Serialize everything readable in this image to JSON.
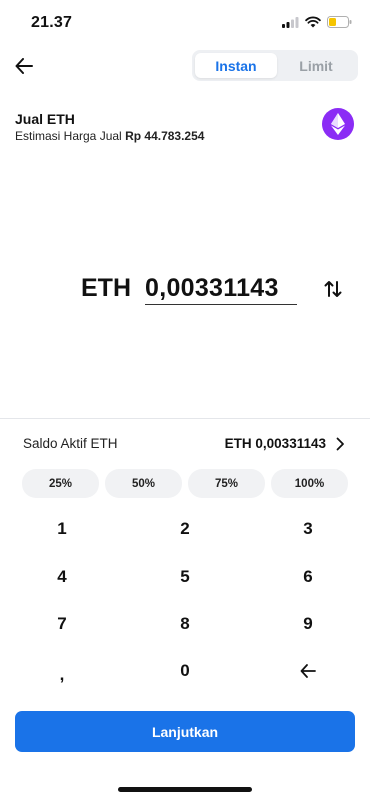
{
  "status_bar": {
    "time": "21.37"
  },
  "header": {
    "tabs": [
      {
        "label": "Instan",
        "active": true
      },
      {
        "label": "Limit",
        "active": false
      }
    ]
  },
  "sell": {
    "title": "Jual ETH",
    "estimate_label": "Estimasi Harga Jual",
    "estimate_value": "Rp 44.783.254"
  },
  "amount": {
    "currency": "ETH",
    "value": "0,00331143"
  },
  "balance": {
    "label": "Saldo Aktif ETH",
    "value": "ETH 0,00331143"
  },
  "percent_buttons": [
    "25%",
    "50%",
    "75%",
    "100%"
  ],
  "keypad": [
    "1",
    "2",
    "3",
    "4",
    "5",
    "6",
    "7",
    "8",
    "9",
    ",",
    "0"
  ],
  "continue_label": "Lanjutkan",
  "colors": {
    "accent": "#1a73e8",
    "eth_logo": "#8b2cf5"
  },
  "icons": [
    "signal-icon",
    "wifi-icon",
    "battery-icon",
    "back-arrow-icon",
    "ethereum-icon",
    "swap-icon",
    "chevron-right-icon",
    "backspace-icon"
  ]
}
